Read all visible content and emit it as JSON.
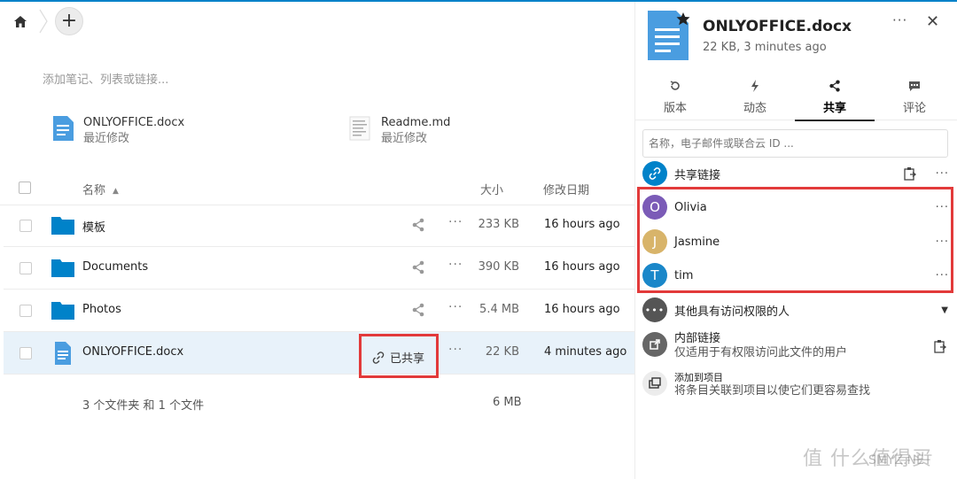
{
  "files": {
    "notes_placeholder": "添加笔记、列表或链接...",
    "recent": [
      {
        "name": "ONLYOFFICE.docx",
        "sub": "最近修改"
      },
      {
        "name": "Readme.md",
        "sub": "最近修改"
      }
    ],
    "headers": {
      "name": "名称",
      "size": "大小",
      "modified": "修改日期"
    },
    "rows": [
      {
        "name": "模板",
        "size": "233 KB",
        "date": "16 hours ago"
      },
      {
        "name": "Documents",
        "size": "390 KB",
        "date": "16 hours ago"
      },
      {
        "name": "Photos",
        "size": "5.4 MB",
        "date": "16 hours ago"
      },
      {
        "name": "ONLYOFFICE.docx",
        "size": "22 KB",
        "date": "4 minutes ago",
        "shared": "已共享"
      }
    ],
    "summary": "3 个文件夹 和 1 个文件",
    "summary_size": "6 MB",
    "more": "···"
  },
  "sidebar": {
    "title": "ONLYOFFICE.docx",
    "subtitle": "22 KB, 3 minutes ago",
    "more": "···",
    "close": "✕",
    "tabs": [
      {
        "label": "版本",
        "icon": "history-icon"
      },
      {
        "label": "动态",
        "icon": "activity-icon"
      },
      {
        "label": "共享",
        "icon": "share-icon",
        "active": true
      },
      {
        "label": "评论",
        "icon": "comment-icon"
      }
    ],
    "search_placeholder": "名称，电子邮件或联合云 ID ...",
    "share_link_label": "共享链接",
    "users": [
      {
        "initial": "O",
        "name": "Olivia",
        "color": "#7b5bb7"
      },
      {
        "initial": "J",
        "name": "Jasmine",
        "color": "#d8b46a"
      },
      {
        "initial": "T",
        "name": "tim",
        "color": "#1a87c9"
      }
    ],
    "others_label": "其他具有访问权限的人",
    "internal_link_title": "内部链接",
    "internal_link_desc": "仅适用于有权限访问此文件的用户",
    "add_project_title": "添加到项目",
    "add_project_desc": "将条目关联到项目以使它们更容易查找"
  },
  "watermark": {
    "text": "值 什么值得买",
    "sub": "SMYZ.NET"
  },
  "colors": {
    "accent": "#0082c9",
    "folder": "#0082c9",
    "highlight": "#e23a3a",
    "doc": "#4a9de0"
  }
}
